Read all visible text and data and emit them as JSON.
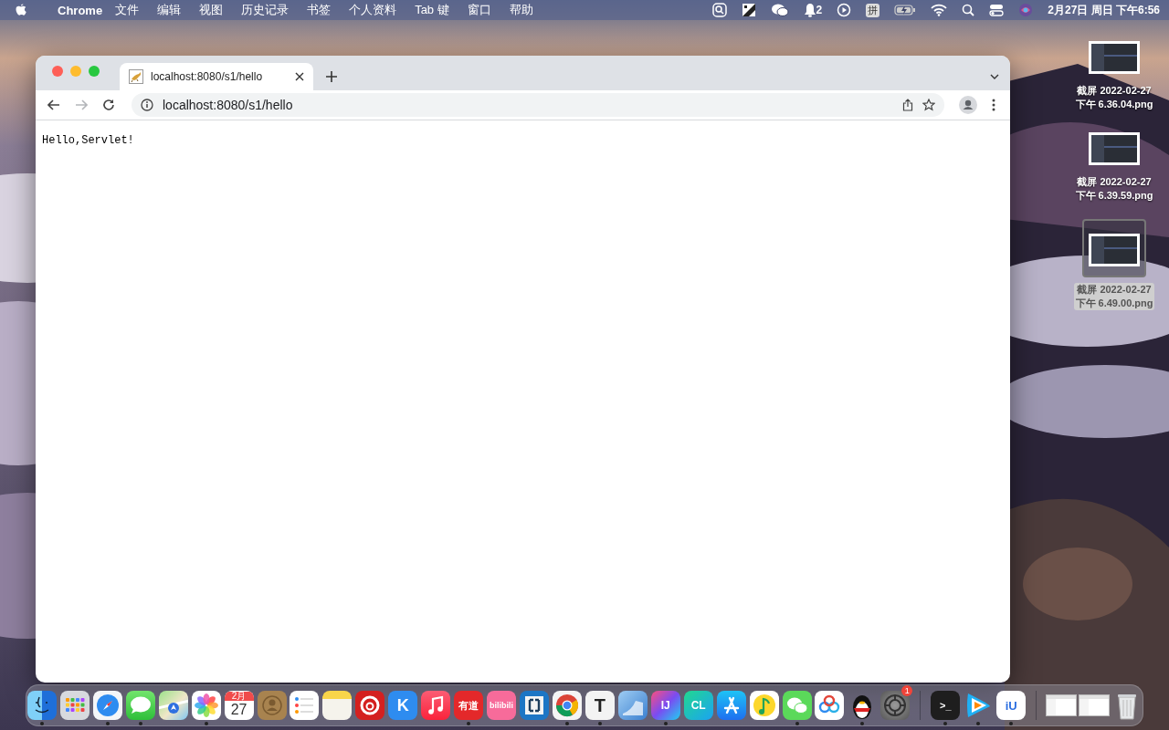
{
  "menu_bar": {
    "app": "Chrome",
    "menus": [
      "文件",
      "编辑",
      "视图",
      "历史记录",
      "书签",
      "个人资料",
      "Tab 键",
      "窗口",
      "帮助"
    ],
    "status_items": [
      {
        "kind": "scan"
      },
      {
        "kind": "tiles"
      },
      {
        "kind": "chat"
      },
      {
        "kind": "bell",
        "count": "2"
      },
      {
        "kind": "play"
      },
      {
        "kind": "input",
        "text": "拼"
      },
      {
        "kind": "battery"
      },
      {
        "kind": "wifi"
      },
      {
        "kind": "search"
      },
      {
        "kind": "toggles"
      },
      {
        "kind": "siri"
      }
    ],
    "clock": "2月27日 周日 下午6:56"
  },
  "browser": {
    "tab": {
      "title": "localhost:8080/s1/hello",
      "selected": true
    },
    "back": {
      "disabled": false
    },
    "forward": {
      "disabled": true
    },
    "address": "localhost:8080/s1/hello",
    "content": "Hello,Servlet!"
  },
  "desktop_files": [
    {
      "label_lines": [
        "截屏 2022-02-27",
        "下午 6.36.04.png"
      ],
      "selected": false
    },
    {
      "label_lines": [
        "截屏 2022-02-27",
        "下午 6.39.59.png"
      ],
      "selected": false
    },
    {
      "label_lines": [
        "截屏 2022-02-27",
        "下午 6.49.00.png"
      ],
      "selected": true
    }
  ],
  "dock": [
    {
      "kind": "finder",
      "running": true
    },
    {
      "kind": "launchpad",
      "running": false
    },
    {
      "kind": "safari",
      "running": true
    },
    {
      "kind": "messages",
      "running": true
    },
    {
      "kind": "maps",
      "running": false
    },
    {
      "kind": "photos",
      "running": true
    },
    {
      "kind": "calendar",
      "month": "2月",
      "text": "27",
      "running": false
    },
    {
      "kind": "contacts",
      "running": false
    },
    {
      "kind": "reminders",
      "running": false
    },
    {
      "kind": "notes",
      "running": false
    },
    {
      "kind": "netease",
      "running": false
    },
    {
      "kind": "kugou",
      "text": "K",
      "running": false
    },
    {
      "kind": "music",
      "running": false
    },
    {
      "kind": "youdao",
      "text": "有道",
      "running": true
    },
    {
      "kind": "bilibili",
      "text": "bilibili",
      "running": false
    },
    {
      "kind": "bracket",
      "running": false
    },
    {
      "kind": "chrome",
      "running": true
    },
    {
      "kind": "typora",
      "text": "T",
      "running": true
    },
    {
      "kind": "blueapp",
      "running": false
    },
    {
      "kind": "intellij",
      "text": "IJ",
      "running": true
    },
    {
      "kind": "clion",
      "text": "CL",
      "running": false
    },
    {
      "kind": "appstore",
      "running": false
    },
    {
      "kind": "qqmusic",
      "running": false
    },
    {
      "kind": "wechat",
      "running": true
    },
    {
      "kind": "baidu",
      "running": false
    },
    {
      "kind": "qq",
      "running": true
    },
    {
      "kind": "sysprefs",
      "badge": "1",
      "running": false
    },
    {
      "kind": "separator"
    },
    {
      "kind": "terminal",
      "text": ">_",
      "running": true
    },
    {
      "kind": "tencentvideo",
      "running": true
    },
    {
      "kind": "iu",
      "text": "iU",
      "running": true
    },
    {
      "kind": "separator"
    },
    {
      "kind": "window"
    },
    {
      "kind": "window"
    },
    {
      "kind": "trash",
      "running": false
    }
  ]
}
